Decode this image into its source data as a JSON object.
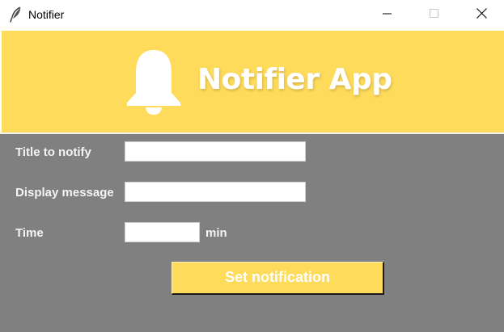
{
  "window": {
    "title": "Notifier",
    "app_icon": "feather-icon",
    "controls": [
      "minimize-icon",
      "maximize-icon",
      "close-icon"
    ]
  },
  "banner": {
    "icon": "bell-icon",
    "title": "Notifier App",
    "background": "#ffdb5b"
  },
  "form": {
    "background": "#808080",
    "title_label": "Title to notify",
    "title_value": "",
    "message_label": "Display message",
    "message_value": "",
    "time_label": "Time",
    "time_value": "",
    "time_unit": "min",
    "submit_label": "Set notification",
    "button_color": "#ffdb5b"
  }
}
